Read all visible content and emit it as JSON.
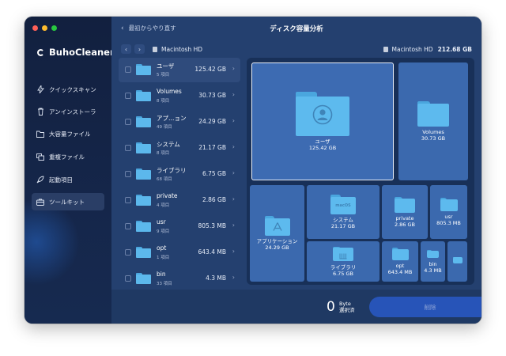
{
  "window": {
    "traffic_colors": {
      "close": "#ff5f57",
      "minimize": "#febc2e",
      "zoom": "#28c840"
    }
  },
  "app": {
    "name": "BuhoCleaner"
  },
  "sidebar": {
    "items": [
      {
        "label": "クイックスキャン",
        "icon": "bolt-icon"
      },
      {
        "label": "アンインストーラ",
        "icon": "trash-icon"
      },
      {
        "label": "大容量ファイル",
        "icon": "folder-icon"
      },
      {
        "label": "重複ファイル",
        "icon": "duplicate-icon"
      },
      {
        "label": "起動項目",
        "icon": "rocket-icon"
      },
      {
        "label": "ツールキット",
        "icon": "toolbox-icon",
        "active": true
      }
    ]
  },
  "header": {
    "back_label": "最初からやり直す",
    "title": "ディスク容量分析"
  },
  "breadcrumb": {
    "path": "Macintosh HD"
  },
  "disk": {
    "name": "Macintosh HD",
    "total": "212.68 GB"
  },
  "list": {
    "items": [
      {
        "name": "ユーザ",
        "count": "5 項目",
        "size": "125.42 GB",
        "selected": true
      },
      {
        "name": "Volumes",
        "count": "8 項目",
        "size": "30.73 GB"
      },
      {
        "name": "アプ…ョン",
        "count": "49 項目",
        "size": "24.29 GB"
      },
      {
        "name": "システム",
        "count": "8 項目",
        "size": "21.17 GB"
      },
      {
        "name": "ライブラリ",
        "count": "68 項目",
        "size": "6.75 GB"
      },
      {
        "name": "private",
        "count": "4 項目",
        "size": "2.86 GB"
      },
      {
        "name": "usr",
        "count": "9 項目",
        "size": "805.3 MB"
      },
      {
        "name": "opt",
        "count": "1 項目",
        "size": "643.4 MB"
      },
      {
        "name": "bin",
        "count": "33 項目",
        "size": "4.3 MB"
      }
    ]
  },
  "treemap": {
    "tiles": [
      {
        "name": "ユーザ",
        "size": "125.42 GB",
        "emblem": "user"
      },
      {
        "name": "Volumes",
        "size": "30.73 GB"
      },
      {
        "name": "アプリケーション",
        "size": "24.29 GB",
        "emblem": "app"
      },
      {
        "name": "システム",
        "size": "21.17 GB",
        "emblem": "macos"
      },
      {
        "name": "private",
        "size": "2.86 GB"
      },
      {
        "name": "usr",
        "size": "805.3 MB"
      },
      {
        "name": "ライブラリ",
        "size": "6.75 GB",
        "emblem": "library"
      },
      {
        "name": "opt",
        "size": "643.4 MB"
      },
      {
        "name": "bin",
        "size": "4.3 MB"
      },
      {
        "name": "",
        "size": ""
      }
    ],
    "macos_text": "macOS"
  },
  "footer": {
    "selected_amount": "0",
    "selected_unit": "Byte",
    "selected_label": "選択済",
    "delete_label": "削除"
  },
  "colors": {
    "accent": "#2754b8",
    "folder": "#5cb8ec",
    "sidebar_bg": "#12203f",
    "main_bg": "#24406f"
  }
}
